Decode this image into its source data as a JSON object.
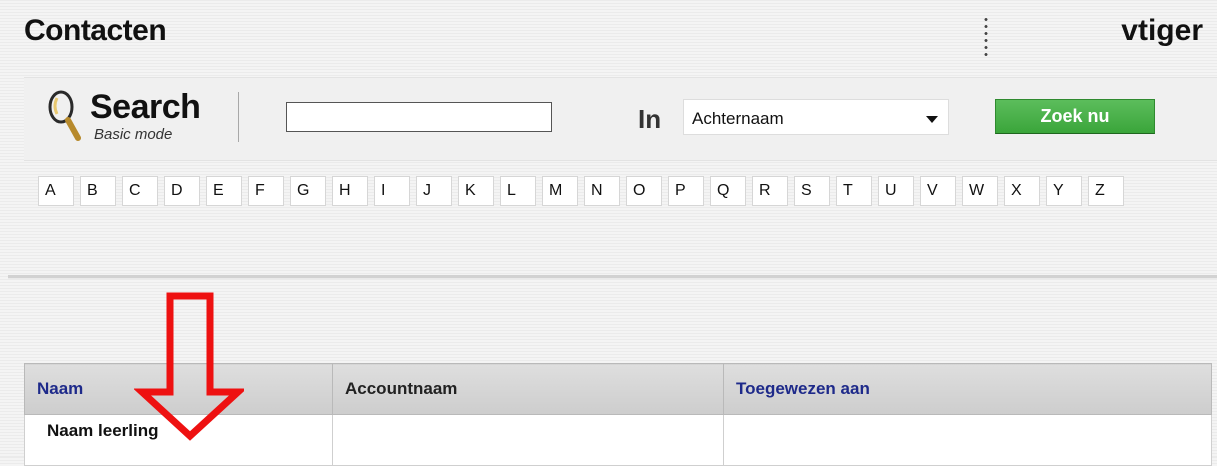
{
  "header": {
    "title": "Contacten",
    "brand": "vtiger"
  },
  "search": {
    "title": "Search",
    "mode": "Basic mode",
    "query": "",
    "in_label": "In",
    "field": "Achternaam",
    "button_label": "Zoek nu"
  },
  "alphabet": [
    "A",
    "B",
    "C",
    "D",
    "E",
    "F",
    "G",
    "H",
    "I",
    "J",
    "K",
    "L",
    "M",
    "N",
    "O",
    "P",
    "Q",
    "R",
    "S",
    "T",
    "U",
    "V",
    "W",
    "X",
    "Y",
    "Z"
  ],
  "table": {
    "columns": [
      {
        "label": "Naam",
        "sortable": true
      },
      {
        "label": "Accountnaam",
        "sortable": false
      },
      {
        "label": "Toegewezen aan",
        "sortable": true
      }
    ],
    "rows": [
      [
        "Naam leerling",
        "",
        ""
      ]
    ]
  },
  "colors": {
    "button_green": "#3aa53a",
    "link_blue": "#1e2a8a",
    "annotation_red": "#ee1111"
  }
}
